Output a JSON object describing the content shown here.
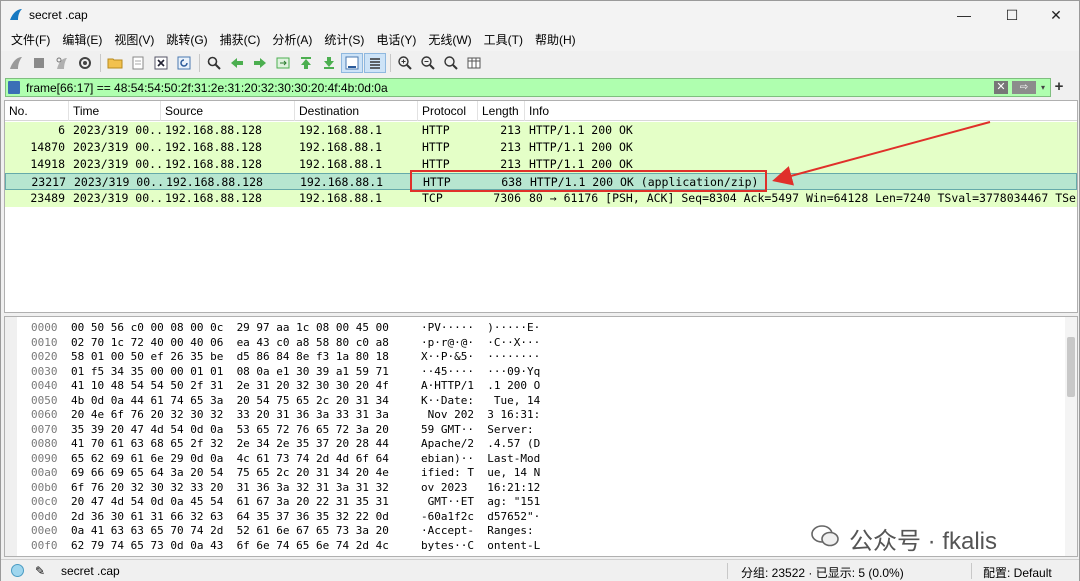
{
  "window": {
    "title": "secret .cap",
    "minimize": "—",
    "maximize": "☐",
    "close": "✕"
  },
  "menu": [
    "文件(F)",
    "编辑(E)",
    "视图(V)",
    "跳转(G)",
    "捕获(C)",
    "分析(A)",
    "统计(S)",
    "电话(Y)",
    "无线(W)",
    "工具(T)",
    "帮助(H)"
  ],
  "filter": {
    "value": "frame[66:17] == 48:54:54:50:2f:31:2e:31:20:32:30:30:20:4f:4b:0d:0a",
    "clear": "✕",
    "apply": "⇨",
    "dropdown": "▾",
    "add": "+"
  },
  "columns": [
    "No.",
    "Time",
    "Source",
    "Destination",
    "Protocol",
    "Length",
    "Info"
  ],
  "packets": [
    {
      "no": "6",
      "time": "2023/319 00...",
      "src": "192.168.88.128",
      "dst": "192.168.88.1",
      "proto": "HTTP",
      "len": "213",
      "info": "HTTP/1.1 200 OK",
      "selected": false
    },
    {
      "no": "14870",
      "time": "2023/319 00...",
      "src": "192.168.88.128",
      "dst": "192.168.88.1",
      "proto": "HTTP",
      "len": "213",
      "info": "HTTP/1.1 200 OK",
      "selected": false
    },
    {
      "no": "14918",
      "time": "2023/319 00...",
      "src": "192.168.88.128",
      "dst": "192.168.88.1",
      "proto": "HTTP",
      "len": "213",
      "info": "HTTP/1.1 200 OK",
      "selected": false
    },
    {
      "no": "23217",
      "time": "2023/319 00...",
      "src": "192.168.88.128",
      "dst": "192.168.88.1",
      "proto": "HTTP",
      "len": "638",
      "info": "HTTP/1.1 200 OK  (application/zip)",
      "selected": true
    },
    {
      "no": "23489",
      "time": "2023/319 00...",
      "src": "192.168.88.128",
      "dst": "192.168.88.1",
      "proto": "TCP",
      "len": "7306",
      "info": "80 → 61176 [PSH, ACK] Seq=8304 Ack=5497 Win=64128 Len=7240 TSval=3778034467 TSe...",
      "selected": false
    }
  ],
  "hex": [
    {
      "off": "0000",
      "bytes": "00 50 56 c0 00 08 00 0c  29 97 aa 1c 08 00 45 00",
      "ascii": "·PV·····  )·····E·"
    },
    {
      "off": "0010",
      "bytes": "02 70 1c 72 40 00 40 06  ea 43 c0 a8 58 80 c0 a8",
      "ascii": "·p·r@·@·  ·C··X···"
    },
    {
      "off": "0020",
      "bytes": "58 01 00 50 ef 26 35 be  d5 86 84 8e f3 1a 80 18",
      "ascii": "X··P·&5·  ········"
    },
    {
      "off": "0030",
      "bytes": "01 f5 34 35 00 00 01 01  08 0a e1 30 39 a1 59 71",
      "ascii": "··45····  ···09·Yq"
    },
    {
      "off": "0040",
      "bytes": "41 10 48 54 54 50 2f 31  2e 31 20 32 30 30 20 4f",
      "ascii": "A·HTTP/1  .1 200 O"
    },
    {
      "off": "0050",
      "bytes": "4b 0d 0a 44 61 74 65 3a  20 54 75 65 2c 20 31 34",
      "ascii": "K··Date:   Tue, 14"
    },
    {
      "off": "0060",
      "bytes": "20 4e 6f 76 20 32 30 32  33 20 31 36 3a 33 31 3a",
      "ascii": " Nov 202  3 16:31:"
    },
    {
      "off": "0070",
      "bytes": "35 39 20 47 4d 54 0d 0a  53 65 72 76 65 72 3a 20",
      "ascii": "59 GMT··  Server: "
    },
    {
      "off": "0080",
      "bytes": "41 70 61 63 68 65 2f 32  2e 34 2e 35 37 20 28 44",
      "ascii": "Apache/2  .4.57 (D"
    },
    {
      "off": "0090",
      "bytes": "65 62 69 61 6e 29 0d 0a  4c 61 73 74 2d 4d 6f 64",
      "ascii": "ebian)··  Last-Mod"
    },
    {
      "off": "00a0",
      "bytes": "69 66 69 65 64 3a 20 54  75 65 2c 20 31 34 20 4e",
      "ascii": "ified: T  ue, 14 N"
    },
    {
      "off": "00b0",
      "bytes": "6f 76 20 32 30 32 33 20  31 36 3a 32 31 3a 31 32",
      "ascii": "ov 2023   16:21:12"
    },
    {
      "off": "00c0",
      "bytes": "20 47 4d 54 0d 0a 45 54  61 67 3a 20 22 31 35 31",
      "ascii": " GMT··ET  ag: \"151"
    },
    {
      "off": "00d0",
      "bytes": "2d 36 30 61 31 66 32 63  64 35 37 36 35 32 22 0d",
      "ascii": "-60a1f2c  d57652\"·"
    },
    {
      "off": "00e0",
      "bytes": "0a 41 63 63 65 70 74 2d  52 61 6e 67 65 73 3a 20",
      "ascii": "·Accept-  Ranges: "
    },
    {
      "off": "00f0",
      "bytes": "62 79 74 65 73 0d 0a 43  6f 6e 74 65 6e 74 2d 4c",
      "ascii": "bytes··C  ontent-L"
    }
  ],
  "watermark": "公众号 · fkalis",
  "status": {
    "file": "secret .cap",
    "counts": "分组: 23522 · 已显示: 5 (0.0%)",
    "profile": "配置: Default"
  }
}
